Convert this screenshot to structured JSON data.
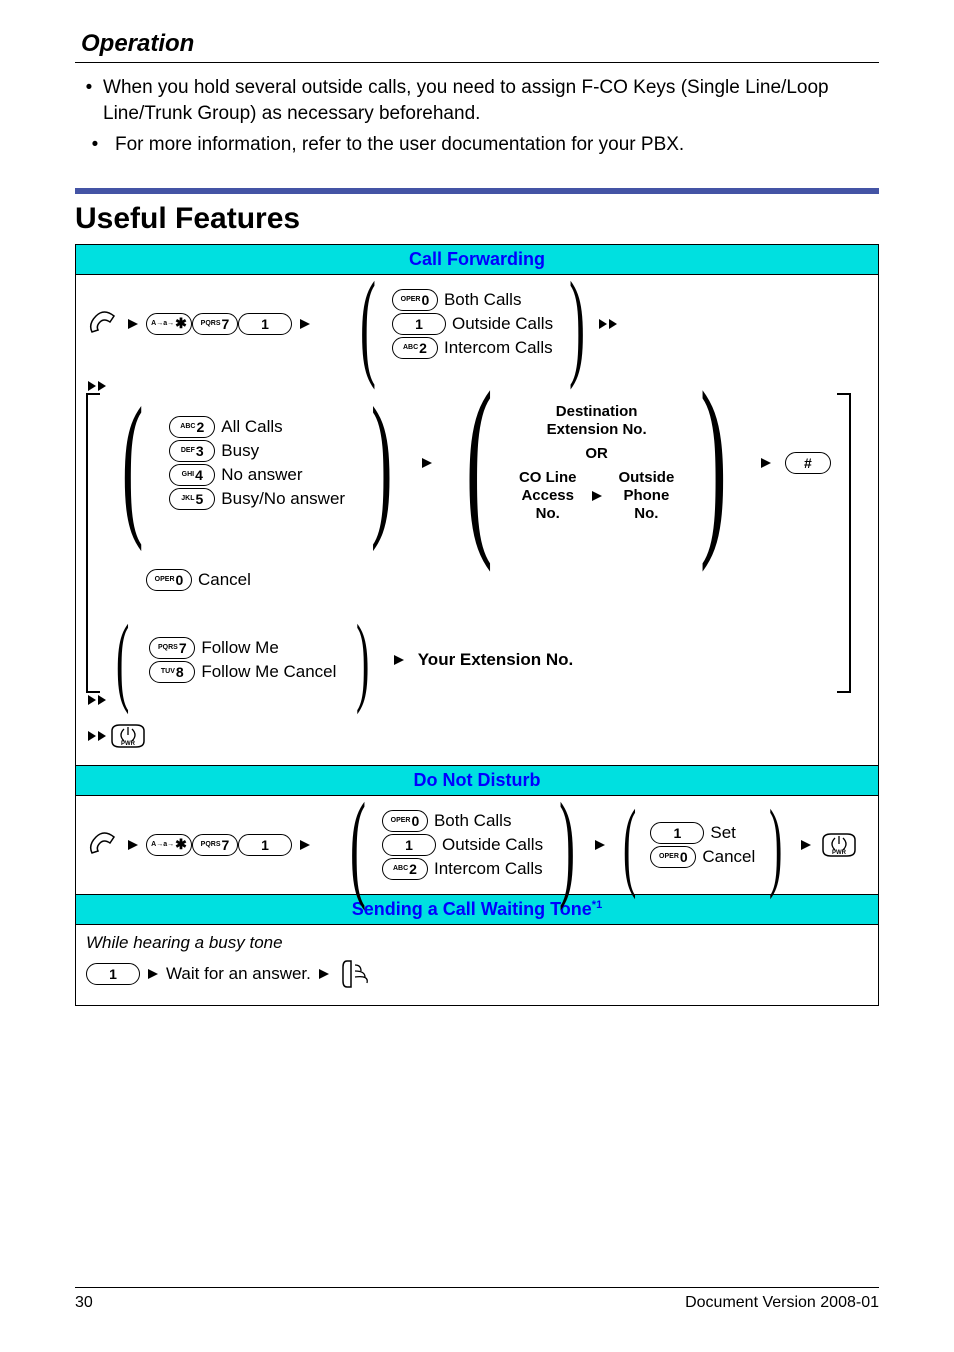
{
  "header": {
    "title": "Operation"
  },
  "bullets": [
    "When you hold several outside calls, you need to assign F-CO Keys (Single Line/Loop Line/Trunk Group) as necessary beforehand.",
    "For more information, refer to the user documentation for your PBX."
  ],
  "useful_features_title": "Useful Features",
  "sections": {
    "call_forwarding": {
      "title": "Call Forwarding",
      "call_types": {
        "k0": "Both Calls",
        "k1": "Outside Calls",
        "k2": "Intercom Calls"
      },
      "conditions": {
        "k2": "All Calls",
        "k3": "Busy",
        "k4": "No answer",
        "k5": "Busy/No answer",
        "k0": "Cancel",
        "k7": "Follow Me",
        "k8": "Follow Me Cancel"
      },
      "dest": {
        "heading": "Destination\nExtension No.",
        "or": "OR",
        "co": "CO Line\nAccess\nNo.",
        "outside": "Outside\nPhone\nNo."
      },
      "your_ext": "Your Extension No."
    },
    "dnd": {
      "title": "Do Not Disturb",
      "call_types": {
        "k0": "Both Calls",
        "k1": "Outside Calls",
        "k2": "Intercom Calls"
      },
      "action": {
        "k1": "Set",
        "k0": "Cancel"
      }
    },
    "call_waiting": {
      "title": "Sending a Call Waiting Tone",
      "sup": "*1",
      "context": "While hearing a busy tone",
      "wait": "Wait for an answer."
    }
  },
  "keys": {
    "star": "A→a→",
    "oper0": "OPER",
    "one": "1",
    "abc2": "ABC",
    "def3": "DEF",
    "ghi4": "GHI",
    "jkl5": "JKL",
    "pqrs7": "PQRS",
    "tuv8": "TUV",
    "hash": "#",
    "pwr": "PWR"
  },
  "footer": {
    "page": "30",
    "version": "Document Version  2008-01"
  }
}
